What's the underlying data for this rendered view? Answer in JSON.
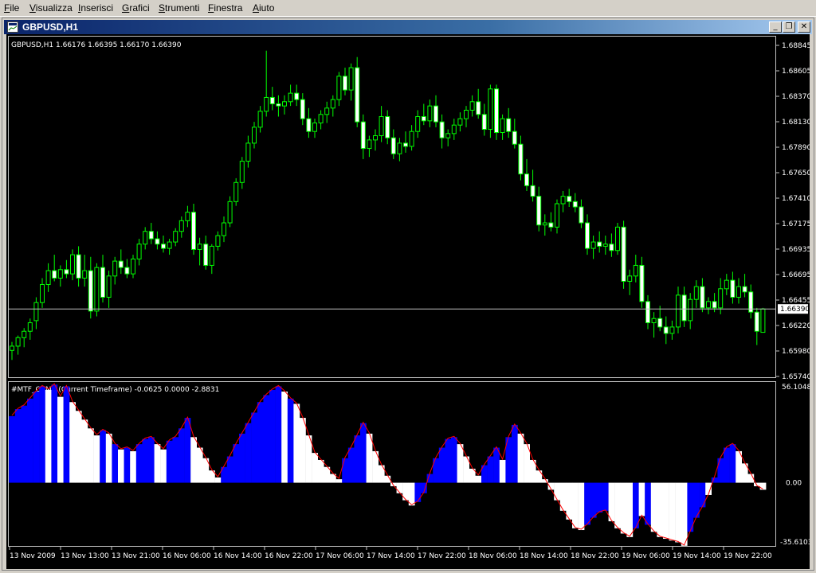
{
  "menu": [
    {
      "label": "File",
      "key": "F"
    },
    {
      "label": "Visualizza",
      "key": "V"
    },
    {
      "label": "Inserisci",
      "key": "I"
    },
    {
      "label": "Grafici",
      "key": "G"
    },
    {
      "label": "Strumenti",
      "key": "S"
    },
    {
      "label": "Finestra",
      "key": "F"
    },
    {
      "label": "Aiuto",
      "key": "A"
    }
  ],
  "window": {
    "title": "GBPUSD,H1",
    "minimize": "_",
    "restore": "❐",
    "close": "✕"
  },
  "price_panel": {
    "info": "GBPUSD,H1  1.66176 1.66395 1.66170 1.66390",
    "price_labels": [
      "1.68845",
      "1.68605",
      "1.68370",
      "1.68130",
      "1.67890",
      "1.67650",
      "1.67410",
      "1.67175",
      "1.66935",
      "1.66695",
      "1.66455",
      "1.66220",
      "1.65980",
      "1.65740"
    ],
    "current_price": "1.66390"
  },
  "indicator_panel": {
    "info": "#MTF_CCM2 (Current Timeframe) -0.0625 0.0000 -2.8831",
    "max_label": "56.1048",
    "zero_label": "0.00",
    "min_label": "-35.61031"
  },
  "time_labels": [
    "13 Nov 2009",
    "13 Nov 13:00",
    "13 Nov 21:00",
    "16 Nov 06:00",
    "16 Nov 14:00",
    "16 Nov 22:00",
    "17 Nov 06:00",
    "17 Nov 14:00",
    "17 Nov 22:00",
    "18 Nov 06:00",
    "18 Nov 14:00",
    "18 Nov 22:00",
    "19 Nov 06:00",
    "19 Nov 14:00",
    "19 Nov 22:00"
  ],
  "colors": {
    "bull": "#000000",
    "bear": "#ffffff",
    "wick": "#00ff00",
    "blue": "#0000ff",
    "white": "#ffffff",
    "red": "#ff0000",
    "grid": "#c0c0c0"
  },
  "chart_data": {
    "type": "candlestick",
    "price_ylim": [
      1.6574,
      1.6896
    ],
    "indicator_ylim": [
      -35.61031,
      56.1048
    ],
    "candles": [
      [
        1.66,
        1.6608,
        1.6591,
        1.6604
      ],
      [
        1.6604,
        1.6614,
        1.6596,
        1.6612
      ],
      [
        1.6612,
        1.6621,
        1.6603,
        1.6618
      ],
      [
        1.6618,
        1.663,
        1.661,
        1.6626
      ],
      [
        1.6628,
        1.665,
        1.662,
        1.6645
      ],
      [
        1.6645,
        1.6668,
        1.664,
        1.6662
      ],
      [
        1.6662,
        1.6682,
        1.6655,
        1.6675
      ],
      [
        1.6675,
        1.669,
        1.6665,
        1.6668
      ],
      [
        1.6668,
        1.668,
        1.666,
        1.6676
      ],
      [
        1.6676,
        1.6685,
        1.6668,
        1.6672
      ],
      [
        1.6672,
        1.6695,
        1.6666,
        1.669
      ],
      [
        1.669,
        1.6698,
        1.666,
        1.6668
      ],
      [
        1.6668,
        1.669,
        1.666,
        1.6675
      ],
      [
        1.6675,
        1.6688,
        1.663,
        1.6637
      ],
      [
        1.6637,
        1.6682,
        1.6632,
        1.6678
      ],
      [
        1.6678,
        1.669,
        1.6645,
        1.665
      ],
      [
        1.665,
        1.6675,
        1.664,
        1.667
      ],
      [
        1.667,
        1.6688,
        1.6662,
        1.6684
      ],
      [
        1.6684,
        1.6695,
        1.6672,
        1.6678
      ],
      [
        1.6678,
        1.6686,
        1.6668,
        1.6672
      ],
      [
        1.6672,
        1.669,
        1.6668,
        1.6686
      ],
      [
        1.6686,
        1.6705,
        1.668,
        1.67
      ],
      [
        1.67,
        1.6716,
        1.6695,
        1.6712
      ],
      [
        1.6712,
        1.672,
        1.67,
        1.6705
      ],
      [
        1.6705,
        1.6712,
        1.6695,
        1.67
      ],
      [
        1.67,
        1.6708,
        1.6692,
        1.6696
      ],
      [
        1.6696,
        1.6705,
        1.669,
        1.6702
      ],
      [
        1.6702,
        1.6715,
        1.6698,
        1.6712
      ],
      [
        1.6712,
        1.6726,
        1.6706,
        1.6722
      ],
      [
        1.6722,
        1.6736,
        1.6716,
        1.673
      ],
      [
        1.673,
        1.6738,
        1.669,
        1.6695
      ],
      [
        1.6695,
        1.6706,
        1.668,
        1.67
      ],
      [
        1.67,
        1.6708,
        1.6676,
        1.668
      ],
      [
        1.668,
        1.67,
        1.6672,
        1.6698
      ],
      [
        1.6698,
        1.6712,
        1.6694,
        1.6708
      ],
      [
        1.6708,
        1.6726,
        1.6702,
        1.672
      ],
      [
        1.672,
        1.6745,
        1.6716,
        1.674
      ],
      [
        1.674,
        1.6762,
        1.6736,
        1.6758
      ],
      [
        1.6758,
        1.6782,
        1.6752,
        1.6778
      ],
      [
        1.6778,
        1.6802,
        1.6772,
        1.6795
      ],
      [
        1.6795,
        1.6815,
        1.679,
        1.681
      ],
      [
        1.681,
        1.683,
        1.6805,
        1.6825
      ],
      [
        1.6825,
        1.6882,
        1.682,
        1.6838
      ],
      [
        1.6838,
        1.6848,
        1.6826,
        1.6832
      ],
      [
        1.6832,
        1.684,
        1.682,
        1.683
      ],
      [
        1.683,
        1.684,
        1.6822,
        1.6834
      ],
      [
        1.6834,
        1.685,
        1.683,
        1.6842
      ],
      [
        1.6842,
        1.685,
        1.683,
        1.6836
      ],
      [
        1.6836,
        1.6842,
        1.6812,
        1.6818
      ],
      [
        1.6818,
        1.6828,
        1.68,
        1.6806
      ],
      [
        1.6806,
        1.6818,
        1.68,
        1.6814
      ],
      [
        1.6814,
        1.6826,
        1.6808,
        1.6822
      ],
      [
        1.6822,
        1.6834,
        1.6814,
        1.6828
      ],
      [
        1.6828,
        1.684,
        1.682,
        1.6836
      ],
      [
        1.6836,
        1.6862,
        1.683,
        1.6858
      ],
      [
        1.6858,
        1.6866,
        1.684,
        1.6845
      ],
      [
        1.6845,
        1.687,
        1.6835,
        1.6866
      ],
      [
        1.6866,
        1.6876,
        1.681,
        1.6815
      ],
      [
        1.6815,
        1.6822,
        1.678,
        1.679
      ],
      [
        1.679,
        1.6802,
        1.6782,
        1.6798
      ],
      [
        1.6798,
        1.6808,
        1.6788,
        1.6802
      ],
      [
        1.6802,
        1.683,
        1.6796,
        1.682
      ],
      [
        1.682,
        1.6826,
        1.6794,
        1.68
      ],
      [
        1.68,
        1.6808,
        1.678,
        1.6785
      ],
      [
        1.6785,
        1.68,
        1.6778,
        1.6795
      ],
      [
        1.6795,
        1.6806,
        1.6786,
        1.6792
      ],
      [
        1.6792,
        1.6812,
        1.6788,
        1.6806
      ],
      [
        1.6806,
        1.6826,
        1.68,
        1.682
      ],
      [
        1.682,
        1.6832,
        1.6812,
        1.6816
      ],
      [
        1.6816,
        1.6836,
        1.681,
        1.683
      ],
      [
        1.683,
        1.684,
        1.681,
        1.6815
      ],
      [
        1.6815,
        1.6822,
        1.679,
        1.68
      ],
      [
        1.68,
        1.6808,
        1.6792,
        1.6804
      ],
      [
        1.6804,
        1.6818,
        1.6798,
        1.6812
      ],
      [
        1.6812,
        1.6824,
        1.6806,
        1.6818
      ],
      [
        1.6818,
        1.683,
        1.681,
        1.6826
      ],
      [
        1.6826,
        1.684,
        1.682,
        1.6834
      ],
      [
        1.6834,
        1.6846,
        1.6818,
        1.6822
      ],
      [
        1.6822,
        1.6832,
        1.6802,
        1.6808
      ],
      [
        1.6808,
        1.685,
        1.68,
        1.6846
      ],
      [
        1.6846,
        1.685,
        1.6798,
        1.6805
      ],
      [
        1.6805,
        1.6822,
        1.6798,
        1.6818
      ],
      [
        1.6818,
        1.6828,
        1.68,
        1.6806
      ],
      [
        1.6806,
        1.6818,
        1.679,
        1.6794
      ],
      [
        1.6794,
        1.6802,
        1.676,
        1.6766
      ],
      [
        1.6766,
        1.678,
        1.675,
        1.6755
      ],
      [
        1.6755,
        1.677,
        1.674,
        1.6745
      ],
      [
        1.6745,
        1.6754,
        1.6712,
        1.6718
      ],
      [
        1.6718,
        1.6728,
        1.6708,
        1.672
      ],
      [
        1.672,
        1.673,
        1.6712,
        1.6716
      ],
      [
        1.6716,
        1.6742,
        1.671,
        1.6738
      ],
      [
        1.6738,
        1.675,
        1.673,
        1.6745
      ],
      [
        1.6745,
        1.6752,
        1.6735,
        1.674
      ],
      [
        1.674,
        1.6748,
        1.673,
        1.6735
      ],
      [
        1.6735,
        1.6742,
        1.6715,
        1.672
      ],
      [
        1.672,
        1.6728,
        1.669,
        1.6696
      ],
      [
        1.6696,
        1.6708,
        1.6686,
        1.6702
      ],
      [
        1.6702,
        1.6712,
        1.6692,
        1.6698
      ],
      [
        1.6698,
        1.6708,
        1.669,
        1.67
      ],
      [
        1.67,
        1.671,
        1.6688,
        1.6694
      ],
      [
        1.6694,
        1.672,
        1.669,
        1.6716
      ],
      [
        1.6716,
        1.6722,
        1.6658,
        1.6665
      ],
      [
        1.6665,
        1.6676,
        1.6652,
        1.667
      ],
      [
        1.667,
        1.669,
        1.6664,
        1.668
      ],
      [
        1.668,
        1.6688,
        1.664,
        1.6646
      ],
      [
        1.6646,
        1.6652,
        1.662,
        1.6626
      ],
      [
        1.6626,
        1.6636,
        1.6612,
        1.663
      ],
      [
        1.663,
        1.6642,
        1.6618,
        1.6622
      ],
      [
        1.6622,
        1.6632,
        1.6606,
        1.6616
      ],
      [
        1.6616,
        1.6628,
        1.661,
        1.6622
      ],
      [
        1.6622,
        1.666,
        1.6616,
        1.6652
      ],
      [
        1.6652,
        1.666,
        1.6622,
        1.6628
      ],
      [
        1.6628,
        1.6654,
        1.662,
        1.6648
      ],
      [
        1.6648,
        1.6666,
        1.664,
        1.666
      ],
      [
        1.666,
        1.6668,
        1.6636,
        1.664
      ],
      [
        1.664,
        1.665,
        1.6634,
        1.6646
      ],
      [
        1.6646,
        1.6654,
        1.6636,
        1.664
      ],
      [
        1.664,
        1.6668,
        1.6634,
        1.6658
      ],
      [
        1.6658,
        1.6672,
        1.6652,
        1.6666
      ],
      [
        1.6666,
        1.6674,
        1.6644,
        1.665
      ],
      [
        1.665,
        1.6668,
        1.6644,
        1.666
      ],
      [
        1.666,
        1.6672,
        1.665,
        1.6655
      ],
      [
        1.6655,
        1.6662,
        1.663,
        1.6636
      ],
      [
        1.6636,
        1.664,
        1.6605,
        1.6618
      ],
      [
        1.6617,
        1.664,
        1.6617,
        1.6639
      ]
    ],
    "indicator": [
      [
        38,
        "b"
      ],
      [
        42,
        "b"
      ],
      [
        44,
        "b"
      ],
      [
        48,
        "b"
      ],
      [
        52,
        "b"
      ],
      [
        55,
        "b"
      ],
      [
        53,
        "w"
      ],
      [
        56,
        "b"
      ],
      [
        49,
        "w"
      ],
      [
        55,
        "b"
      ],
      [
        46,
        "w"
      ],
      [
        41,
        "w"
      ],
      [
        36,
        "w"
      ],
      [
        31,
        "w"
      ],
      [
        27,
        "w"
      ],
      [
        30,
        "b"
      ],
      [
        28,
        "w"
      ],
      [
        22,
        "b"
      ],
      [
        19,
        "w"
      ],
      [
        20,
        "b"
      ],
      [
        18,
        "w"
      ],
      [
        22,
        "b"
      ],
      [
        25,
        "b"
      ],
      [
        26,
        "b"
      ],
      [
        22,
        "w"
      ],
      [
        19,
        "w"
      ],
      [
        24,
        "b"
      ],
      [
        26,
        "b"
      ],
      [
        31,
        "b"
      ],
      [
        37,
        "b"
      ],
      [
        26,
        "w"
      ],
      [
        20,
        "w"
      ],
      [
        14,
        "w"
      ],
      [
        7,
        "w"
      ],
      [
        3,
        "w"
      ],
      [
        9,
        "b"
      ],
      [
        15,
        "b"
      ],
      [
        22,
        "b"
      ],
      [
        28,
        "b"
      ],
      [
        34,
        "b"
      ],
      [
        40,
        "b"
      ],
      [
        46,
        "b"
      ],
      [
        50,
        "b"
      ],
      [
        53,
        "b"
      ],
      [
        55,
        "b"
      ],
      [
        52,
        "w"
      ],
      [
        48,
        "b"
      ],
      [
        45,
        "w"
      ],
      [
        37,
        "w"
      ],
      [
        27,
        "w"
      ],
      [
        17,
        "w"
      ],
      [
        13,
        "w"
      ],
      [
        9,
        "w"
      ],
      [
        5,
        "w"
      ],
      [
        2,
        "w"
      ],
      [
        14,
        "b"
      ],
      [
        20,
        "b"
      ],
      [
        27,
        "b"
      ],
      [
        34,
        "b"
      ],
      [
        28,
        "w"
      ],
      [
        18,
        "w"
      ],
      [
        10,
        "w"
      ],
      [
        4,
        "w"
      ],
      [
        -2,
        "w"
      ],
      [
        -6,
        "w"
      ],
      [
        -10,
        "w"
      ],
      [
        -13,
        "w"
      ],
      [
        -11,
        "b"
      ],
      [
        -6,
        "b"
      ],
      [
        5,
        "b"
      ],
      [
        14,
        "b"
      ],
      [
        20,
        "b"
      ],
      [
        25,
        "b"
      ],
      [
        26,
        "b"
      ],
      [
        22,
        "w"
      ],
      [
        15,
        "w"
      ],
      [
        8,
        "w"
      ],
      [
        4,
        "w"
      ],
      [
        10,
        "b"
      ],
      [
        15,
        "b"
      ],
      [
        20,
        "b"
      ],
      [
        13,
        "w"
      ],
      [
        26,
        "b"
      ],
      [
        33,
        "b"
      ],
      [
        28,
        "w"
      ],
      [
        22,
        "w"
      ],
      [
        13,
        "w"
      ],
      [
        7,
        "w"
      ],
      [
        2,
        "w"
      ],
      [
        -4,
        "w"
      ],
      [
        -10,
        "w"
      ],
      [
        -16,
        "w"
      ],
      [
        -21,
        "w"
      ],
      [
        -26,
        "w"
      ],
      [
        -27,
        "w"
      ],
      [
        -24,
        "b"
      ],
      [
        -20,
        "b"
      ],
      [
        -17,
        "b"
      ],
      [
        -16,
        "b"
      ],
      [
        -22,
        "w"
      ],
      [
        -26,
        "w"
      ],
      [
        -29,
        "w"
      ],
      [
        -31,
        "w"
      ],
      [
        -26,
        "b"
      ],
      [
        -19,
        "w"
      ],
      [
        -24,
        "b"
      ],
      [
        -28,
        "w"
      ],
      [
        -31,
        "w"
      ],
      [
        -32,
        "w"
      ],
      [
        -33,
        "w"
      ],
      [
        -34,
        "w"
      ],
      [
        -36,
        "w"
      ],
      [
        -28,
        "b"
      ],
      [
        -20,
        "b"
      ],
      [
        -14,
        "b"
      ],
      [
        -7,
        "w"
      ],
      [
        3,
        "b"
      ],
      [
        14,
        "b"
      ],
      [
        20,
        "b"
      ],
      [
        22,
        "b"
      ],
      [
        18,
        "w"
      ],
      [
        11,
        "w"
      ],
      [
        5,
        "w"
      ],
      [
        -2,
        "w"
      ],
      [
        -4,
        "w"
      ]
    ]
  }
}
